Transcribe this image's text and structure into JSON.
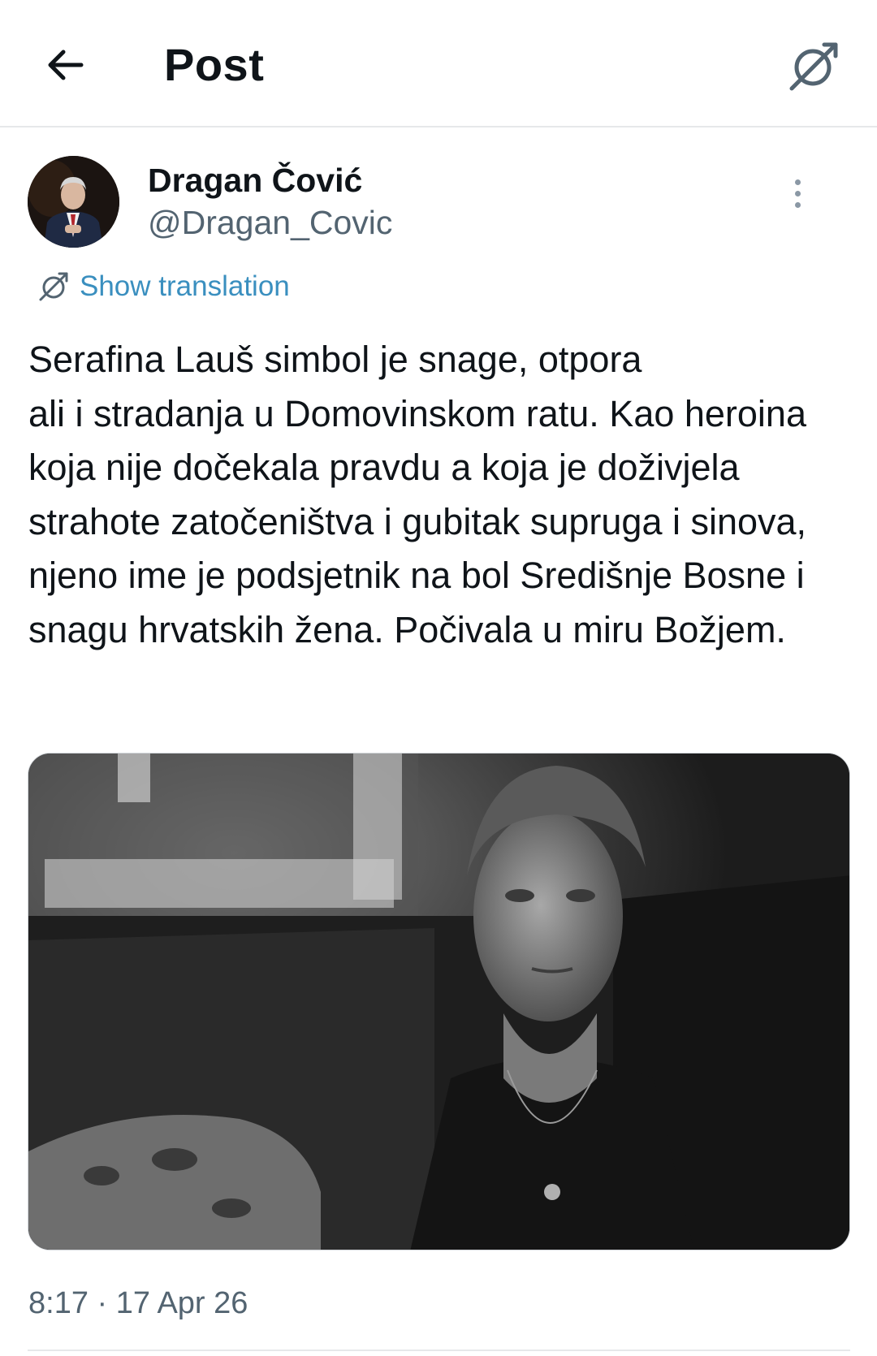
{
  "header": {
    "title": "Post",
    "back_icon": "arrow-left-icon",
    "translate_icon": "translate-icon"
  },
  "author": {
    "name": "Dragan Čović",
    "handle": "@Dragan_Covic",
    "more_icon": "more-vertical-icon"
  },
  "translation": {
    "label": "Show translation",
    "icon": "translate-icon",
    "color": "#3a8fbf"
  },
  "tweet": {
    "text": "Serafina Lauš simbol je snage, otpora\nali i stradanja u Domovinskom ratu. Kao heroina koja nije dočekala pravdu a koja je doživjela strahote zatočeništva i gubitak supruga i sinova, njeno ime je podsjetnik na bol Središnje Bosne i snagu hrvatskih žena. Počivala u miru Božjem.",
    "media": "black-and-white portrait photo",
    "timestamp": "8:17 · 17 Apr 26"
  },
  "colors": {
    "text_primary": "#0f1419",
    "text_secondary": "#536471",
    "divider": "#e6e8ea"
  }
}
